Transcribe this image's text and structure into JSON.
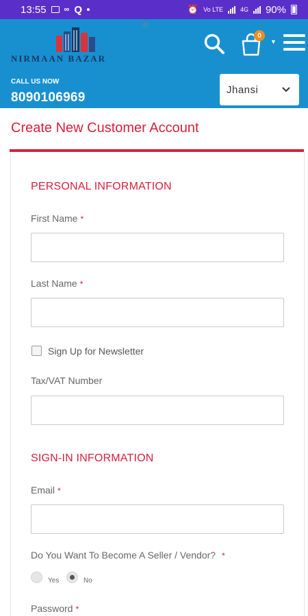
{
  "status_bar": {
    "time": "13:55",
    "network_label": "Vo LTE",
    "network_label_2": "4G",
    "battery": "90%"
  },
  "header": {
    "brand_name": "NIRMAAN BAZAR",
    "cart_count": "0",
    "call_label": "CALL US NOW",
    "phone": "8090106969",
    "city_selected": "Jhansi"
  },
  "icons": [
    "search-icon",
    "cart-icon",
    "menu-icon",
    "chevron-down-icon"
  ],
  "colors": {
    "status_bar": "#5a2ec8",
    "header": "#1890d0",
    "accent_red": "#d6213b",
    "badge_orange": "#f68b1f"
  },
  "page": {
    "title": "Create New Customer Account"
  },
  "personal": {
    "heading": "PERSONAL INFORMATION",
    "first_name_label": "First Name",
    "last_name_label": "Last Name",
    "newsletter_label": "Sign Up for Newsletter",
    "taxvat_label": "Tax/VAT Number",
    "required_mark": "*"
  },
  "signin": {
    "heading": "SIGN-IN INFORMATION",
    "email_label": "Email",
    "seller_label": "Do You Want To Become A Seller / Vendor?",
    "yes_label": "Yes",
    "no_label": "No",
    "seller_selected": "No",
    "password_label": "Password"
  }
}
